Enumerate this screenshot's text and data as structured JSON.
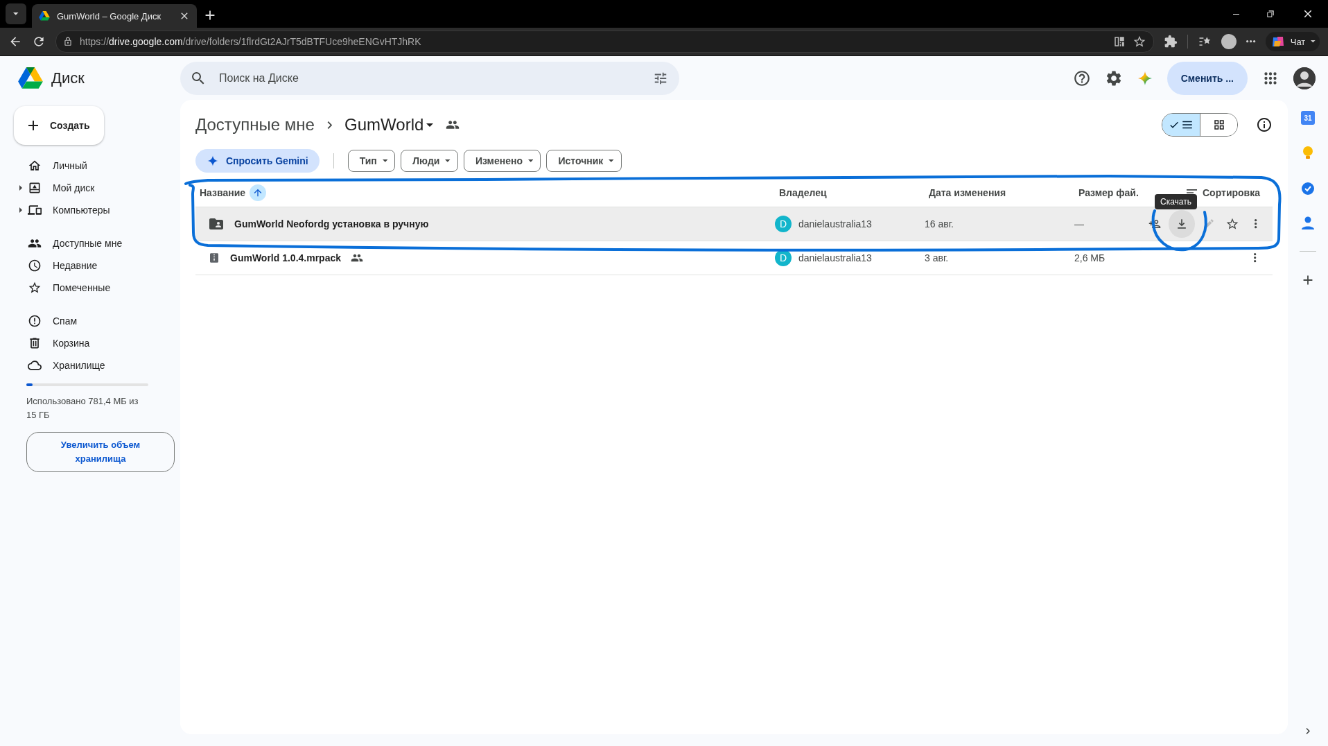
{
  "browser": {
    "tab_title": "GumWorld – Google Диск",
    "url_scheme": "https://",
    "url_host": "drive.google.com",
    "url_path": "/drive/folders/1flrdGt2AJrT5dBTFUce9heENGvHTJhRK",
    "copilot_label": "Чат"
  },
  "header": {
    "logo_text": "Диск",
    "search": {
      "placeholder": "Поиск на Диске"
    },
    "switch_button": "Сменить ..."
  },
  "sidebar": {
    "create_button": "Создать",
    "groups": [
      [
        {
          "label": "Личный",
          "kind": "plain"
        },
        {
          "label": "Мой диск",
          "kind": "expandable"
        },
        {
          "label": "Компьютеры",
          "kind": "expandable"
        }
      ],
      [
        {
          "label": "Доступные мне",
          "kind": "plain"
        },
        {
          "label": "Недавние",
          "kind": "plain"
        },
        {
          "label": "Помеченные",
          "kind": "plain"
        }
      ],
      [
        {
          "label": "Спам",
          "kind": "plain"
        },
        {
          "label": "Корзина",
          "kind": "plain"
        },
        {
          "label": "Хранилище",
          "kind": "plain"
        }
      ]
    ],
    "storage": {
      "level": 0.05,
      "text": "Использовано 781,4 МБ из 15 ГБ",
      "button": "Увеличить объем хранилища"
    }
  },
  "main": {
    "breadcrumb": [
      "Доступные мне",
      "GumWorld"
    ],
    "view_toggle": [
      {
        "selected": true
      },
      {
        "selected": false
      }
    ],
    "gemini_button": "Спросить Gemini",
    "filters": [
      "Тип",
      "Люди",
      "Изменено",
      "Источник"
    ],
    "table": {
      "columns": [
        {
          "label": "Название",
          "sorted": true
        },
        {
          "label": "Владелец",
          "sorted": false
        },
        {
          "label": "Дата изменения",
          "sorted": false
        },
        {
          "label": "Размер фай.",
          "sorted": false
        }
      ],
      "sort_button": "Сортировка",
      "tooltip": "Скачать",
      "rows": [
        {
          "name": "GumWorld Neofordg установка в ручную",
          "kind": "folder",
          "shared": false,
          "owner_initial": "D",
          "owner": "danielaustralia13",
          "modified": "16 авг.",
          "size": "—",
          "selected": true
        },
        {
          "name": "GumWorld 1.0.4.mrpack",
          "kind": "archive",
          "shared": true,
          "owner_initial": "D",
          "owner": "danielaustralia13",
          "modified": "3 авг.",
          "size": "2,6 МБ",
          "selected": false
        }
      ]
    }
  },
  "side_panel": {
    "calendar_day": "31"
  }
}
